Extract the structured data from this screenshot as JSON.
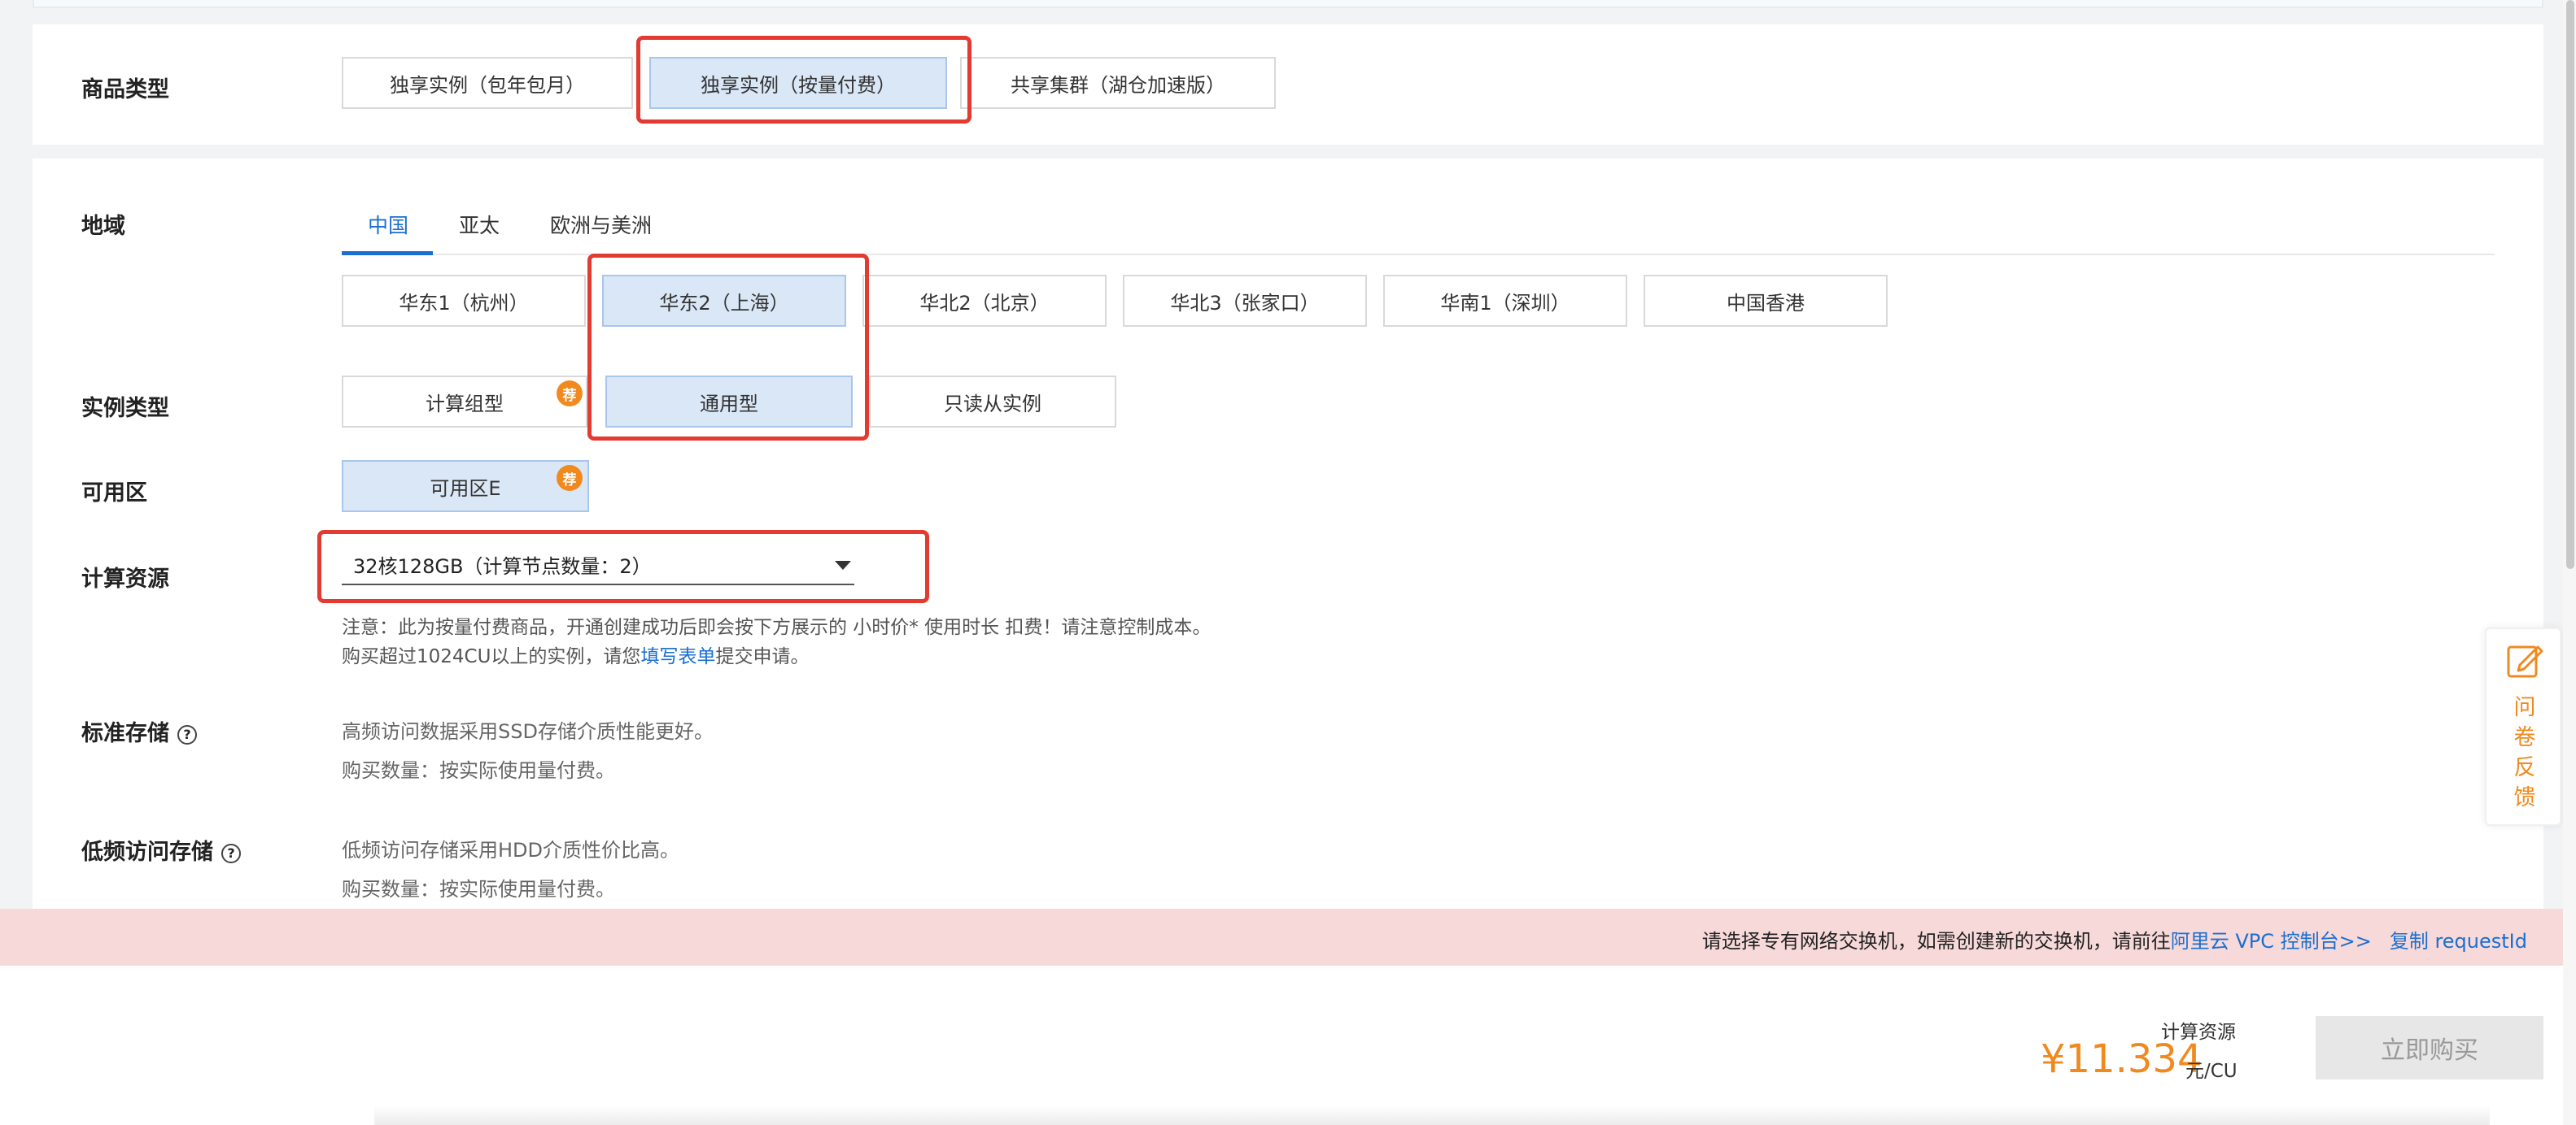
{
  "product_type": {
    "label": "商品类型",
    "options": [
      "独享实例（包年包月）",
      "独享实例（按量付费）",
      "共享集群（湖仓加速版）"
    ],
    "selected_index": 1
  },
  "region": {
    "label": "地域",
    "tabs": [
      "中国",
      "亚太",
      "欧洲与美洲"
    ],
    "active_tab": 0,
    "options": [
      "华东1（杭州）",
      "华东2（上海）",
      "华北2（北京）",
      "华北3（张家口）",
      "华南1（深圳）",
      "中国香港"
    ],
    "selected_index": 1
  },
  "instance_type": {
    "label": "实例类型",
    "options": [
      "计算组型",
      "通用型",
      "只读从实例"
    ],
    "badge": "荐",
    "selected_index": 1
  },
  "zone": {
    "label": "可用区",
    "options": [
      "可用区E"
    ],
    "badge": "荐"
  },
  "compute": {
    "label": "计算资源",
    "selected": "32核128GB（计算节点数量：2）",
    "note1": "注意：此为按量付费商品，开通创建成功后即会按下方展示的 小时价* 使用时长 扣费！请注意控制成本。",
    "note2_prefix": "购买超过1024CU以上的实例，请您",
    "note2_link": "填写表单",
    "note2_suffix": "提交申请。"
  },
  "std_storage": {
    "label": "标准存储",
    "help": "?",
    "desc": "高频访问数据采用SSD存储介质性能更好。",
    "qty": "购买数量：按实际使用量付费。"
  },
  "low_storage": {
    "label": "低频访问存储",
    "help": "?",
    "desc": "低频访问存储采用HDD介质性价比高。",
    "qty": "购买数量：按实际使用量付费。"
  },
  "alert": {
    "text": "请选择专有网络交换机，如需创建新的交换机，请前往",
    "link": "阿里云 VPC 控制台>>",
    "copy": "复制 requestId"
  },
  "footer": {
    "price_label": "计算资源",
    "price": "¥11.334",
    "price_unit": "元/CU",
    "buy_label": "立即购买"
  },
  "feedback": {
    "text": [
      "问",
      "卷",
      "反",
      "馈"
    ]
  },
  "colors": {
    "accent": "#1a6fd1",
    "orange": "#f08a1f",
    "highlight": "#e33a31",
    "selected_bg": "#dae7f7"
  }
}
